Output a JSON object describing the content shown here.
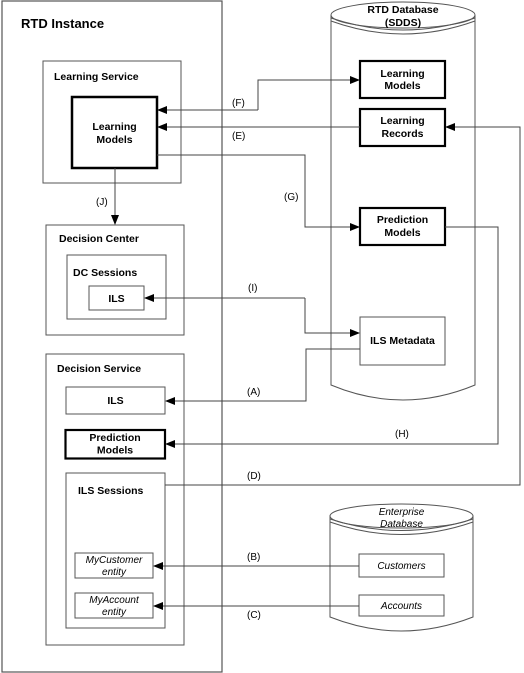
{
  "rtd_instance": {
    "title": "RTD Instance",
    "learning_service": {
      "title": "Learning Service",
      "learning_models": [
        "Learning",
        "Models"
      ]
    },
    "decision_center": {
      "title": "Decision Center",
      "dc_sessions": {
        "title": "DC Sessions",
        "ils": "ILS"
      }
    },
    "decision_service": {
      "title": "Decision Service",
      "ils": "ILS",
      "prediction_models": [
        "Prediction",
        "Models"
      ],
      "ils_sessions": {
        "title": "ILS Sessions",
        "my_customer": [
          "MyCustomer",
          "entity"
        ],
        "my_account": [
          "MyAccount",
          "entity"
        ]
      }
    }
  },
  "rtd_database": {
    "title": [
      "RTD Database",
      "(SDDS)"
    ],
    "learning_models": [
      "Learning",
      "Models"
    ],
    "learning_records": [
      "Learning",
      "Records"
    ],
    "prediction_models": [
      "Prediction",
      "Models"
    ],
    "ils_metadata": "ILS Metadata"
  },
  "enterprise_database": {
    "title": [
      "Enterprise",
      "Database"
    ],
    "customers": "Customers",
    "accounts": "Accounts"
  },
  "connectors": {
    "A": "(A)",
    "B": "(B)",
    "C": "(C)",
    "D": "(D)",
    "E": "(E)",
    "F": "(F)",
    "G": "(G)",
    "H": "(H)",
    "I": "(I)",
    "J": "(J)"
  },
  "colors": {
    "line": "#444444",
    "box": "#555555",
    "thick": "#000000"
  }
}
